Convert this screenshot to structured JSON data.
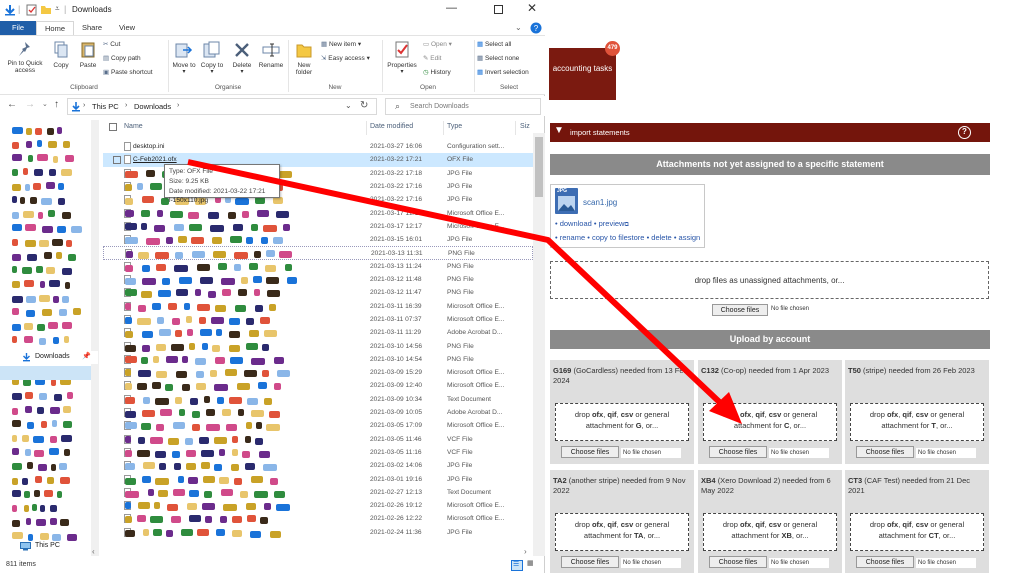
{
  "explorer": {
    "window_title": "Downloads",
    "tabs": [
      "File",
      "Home",
      "Share",
      "View"
    ],
    "clipboard": {
      "pin": "Pin to Quick access",
      "copy": "Copy",
      "paste": "Paste",
      "cut": "Cut",
      "copy_path": "Copy path",
      "paste_shortcut": "Paste shortcut",
      "group": "Clipboard"
    },
    "organise": {
      "move_to": "Move to",
      "copy_to": "Copy to",
      "delete": "Delete",
      "rename": "Rename",
      "group": "Organise"
    },
    "new": {
      "new_folder": "New folder",
      "new_item": "New item",
      "easy_access": "Easy access",
      "group": "New"
    },
    "open": {
      "properties": "Properties",
      "open": "Open",
      "edit": "Edit",
      "history": "History",
      "group": "Open"
    },
    "select": {
      "select_all": "Select all",
      "select_none": "Select none",
      "invert": "Invert selection",
      "group": "Select"
    },
    "breadcrumb": [
      "This PC",
      "Downloads"
    ],
    "search_placeholder": "Search Downloads",
    "columns": {
      "name": "Name",
      "date": "Date modified",
      "type": "Type",
      "size": "Siz"
    },
    "nav": {
      "downloads": "Downloads",
      "this_pc": "This PC"
    },
    "tooltip": {
      "type": "Type: OFX File",
      "size": "Size: 9.25 KB",
      "date": "Date modified: 2021-03-22 17:21",
      "peek": "l-150x110.jpg"
    },
    "files": [
      {
        "name": "desktop.ini",
        "date": "2021-03-27 16:06",
        "type": "Configuration sett..."
      },
      {
        "name": "C-Feb2021.ofx",
        "date": "2021-03-22 17:21",
        "type": "OFX File"
      },
      {
        "name": "",
        "date": "2021-03-22 17:18",
        "type": "JPG File"
      },
      {
        "name": "",
        "date": "2021-03-22 17:16",
        "type": "JPG File"
      },
      {
        "name": "",
        "date": "2021-03-22 17:16",
        "type": "JPG File"
      },
      {
        "name": "",
        "date": "2021-03-17 12:17",
        "type": "Microsoft Office E..."
      },
      {
        "name": "",
        "date": "2021-03-17 12:17",
        "type": "Microsoft Office E..."
      },
      {
        "name": "",
        "date": "2021-03-15 16:01",
        "type": "JPG File"
      },
      {
        "name": "",
        "date": "2021-03-13 11:31",
        "type": "PNG File"
      },
      {
        "name": "",
        "date": "2021-03-13 11:24",
        "type": "PNG File"
      },
      {
        "name": "",
        "date": "2021-03-12 11:48",
        "type": "PNG File"
      },
      {
        "name": "",
        "date": "2021-03-12 11:47",
        "type": "PNG File"
      },
      {
        "name": "",
        "date": "2021-03-11 16:39",
        "type": "Microsoft Office E..."
      },
      {
        "name": "",
        "date": "2021-03-11 07:37",
        "type": "Microsoft Office E..."
      },
      {
        "name": "",
        "date": "2021-03-11 11:29",
        "type": "Adobe Acrobat D..."
      },
      {
        "name": "",
        "date": "2021-03-10 14:56",
        "type": "PNG File"
      },
      {
        "name": "",
        "date": "2021-03-10 14:54",
        "type": "PNG File"
      },
      {
        "name": "",
        "date": "2021-03-09 15:29",
        "type": "Microsoft Office E..."
      },
      {
        "name": "",
        "date": "2021-03-09 12:40",
        "type": "Microsoft Office E..."
      },
      {
        "name": "",
        "date": "2021-03-09 10:34",
        "type": "Text Document"
      },
      {
        "name": "",
        "date": "2021-03-09 10:05",
        "type": "Adobe Acrobat D..."
      },
      {
        "name": "",
        "date": "2021-03-05 17:09",
        "type": "Microsoft Office E..."
      },
      {
        "name": "",
        "date": "2021-03-05 11:46",
        "type": "VCF File"
      },
      {
        "name": "",
        "date": "2021-03-05 11:16",
        "type": "VCF File"
      },
      {
        "name": "",
        "date": "2021-03-02 14:06",
        "type": "JPG File"
      },
      {
        "name": "",
        "date": "2021-03-01 19:16",
        "type": "JPG File"
      },
      {
        "name": "",
        "date": "2021-02-27 12:13",
        "type": "Text Document"
      },
      {
        "name": "",
        "date": "2021-02-26 19:12",
        "type": "Microsoft Office E..."
      },
      {
        "name": "",
        "date": "2021-02-26 12:22",
        "type": "Microsoft Office E..."
      },
      {
        "name": "",
        "date": "2021-02-24 11:36",
        "type": "JPG File"
      }
    ],
    "status": "811 items"
  },
  "app": {
    "tile": {
      "label": "accounting tasks",
      "badge": "479"
    },
    "import_header": "import statements",
    "help": "?",
    "unassigned_header": "Attachments not yet assigned to a specific statement",
    "attachment": {
      "badge": "JPG",
      "filename": "scan1.jpg",
      "line1": [
        "• download",
        "• preview"
      ],
      "line2": [
        "• rename",
        "• copy to filestore",
        "• delete",
        "• assign"
      ]
    },
    "unassigned_drop": "drop files as unassigned attachments, or...",
    "choose_files": "Choose files",
    "no_file": "No file chosen",
    "upload_header": "Upload by account",
    "accounts": [
      {
        "code": "G169",
        "rest": "(GoCardless) needed from 13 Feb 2024",
        "letter": "G"
      },
      {
        "code": "C132",
        "rest": "(Co-op) needed from 1 Apr 2023",
        "letter": "C"
      },
      {
        "code": "T50",
        "rest": "(stripe) needed from 26 Feb 2023",
        "letter": "T"
      },
      {
        "code": "TA2",
        "rest": "(another stripe) needed from 9 Nov 2022",
        "letter": "TA"
      },
      {
        "code": "XB4",
        "rest": "(Xero Download 2) needed from 6 May 2022",
        "letter": "XB"
      },
      {
        "code": "CT3",
        "rest": "(CAF Test) needed from 21 Dec 2021",
        "letter": "CT"
      }
    ],
    "drop_prefix": "drop",
    "formats": [
      "ofx",
      "qif",
      "csv"
    ],
    "drop_mid": "or general",
    "drop_suffix_a": "attachment for",
    "drop_suffix_b": ", or..."
  },
  "colors": {
    "brand": "#74150c",
    "arrow": "#ff0000",
    "grey_bar": "#8a8a8a"
  }
}
